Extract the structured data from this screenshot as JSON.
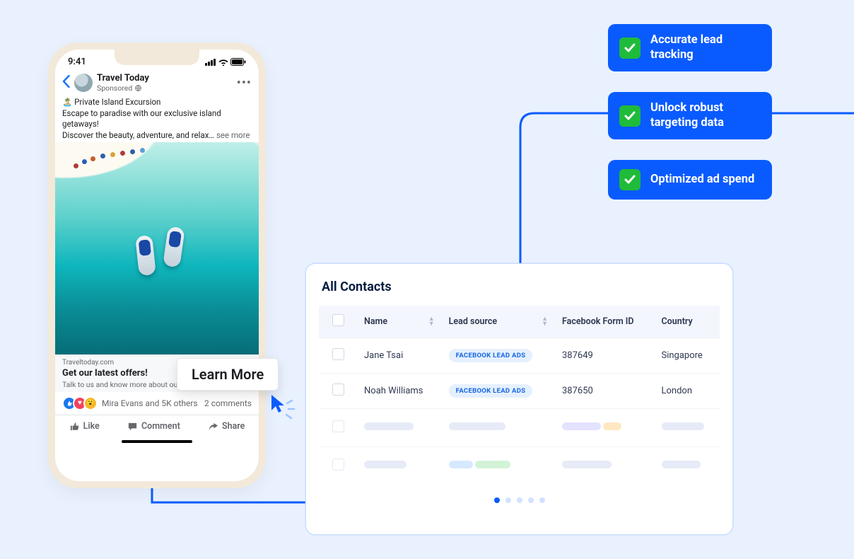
{
  "phone": {
    "time": "9:41",
    "page_name": "Travel Today",
    "sponsored_label": "Sponsored",
    "post_line1": "🏝️ Private Island Excursion",
    "post_line2": "Escape to paradise with our exclusive island getaways!",
    "post_line3_prefix": "Discover the beauty, adventure, and relax… ",
    "see_more": "see more",
    "link_domain": "Traveltoday.com",
    "link_title": "Get our latest offers!",
    "link_sub": "Talk to us and know more about our p",
    "reactions_text": "Mira Evans and 5K others",
    "comments_text": "2 comments",
    "like": "Like",
    "comment": "Comment",
    "share": "Share"
  },
  "learn_more": "Learn More",
  "panel": {
    "title": "All Contacts",
    "headers": {
      "name": "Name",
      "lead_source": "Lead source",
      "form_id": "Facebook Form ID",
      "country": "Country"
    },
    "lead_pill": "FACEBOOK LEAD ADS",
    "rows": [
      {
        "name": "Jane Tsai",
        "form_id": "387649",
        "country": "Singapore"
      },
      {
        "name": "Noah Williams",
        "form_id": "387650",
        "country": "London"
      }
    ]
  },
  "benefits": {
    "b1": "Accurate lead tracking",
    "b2": "Unlock robust targeting data",
    "b3": "Optimized ad spend"
  }
}
